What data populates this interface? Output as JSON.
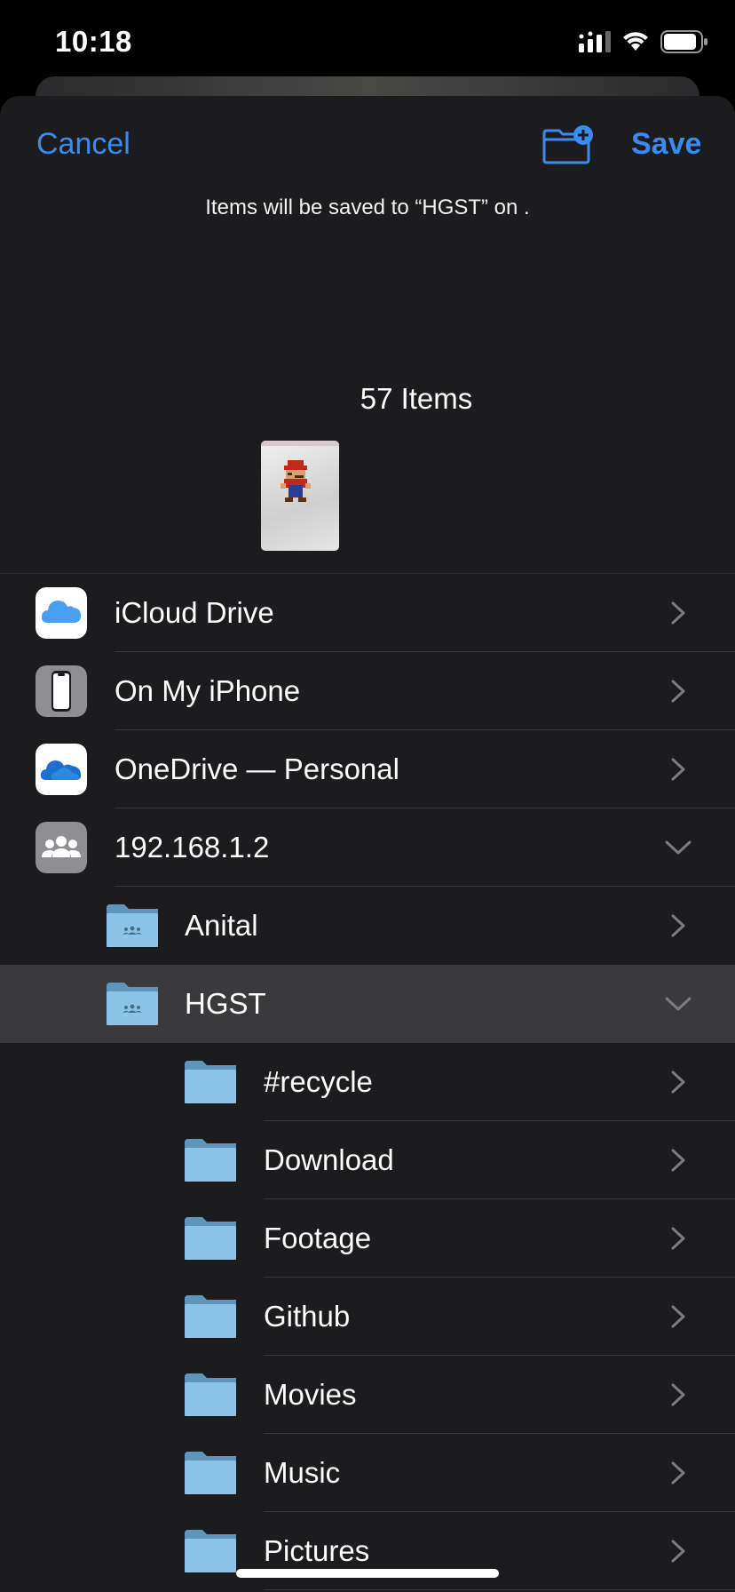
{
  "status_bar": {
    "time": "10:18"
  },
  "nav": {
    "cancel_label": "Cancel",
    "save_label": "Save"
  },
  "save_message": "Items will be saved to “HGST” on .",
  "item_count": "57 Items",
  "colors": {
    "accent": "#3a8bf0",
    "sheet_bg": "#1c1c1e",
    "selected_row": "#3a3a3c",
    "folder_blue": "#8cc4e8"
  },
  "locations": [
    {
      "label": "iCloud Drive",
      "icon": "icloud-icon",
      "chevron": "right"
    },
    {
      "label": "On My iPhone",
      "icon": "iphone-icon",
      "chevron": "right"
    },
    {
      "label": "OneDrive — Personal",
      "icon": "onedrive-icon",
      "chevron": "right"
    },
    {
      "label": "192.168.1.2",
      "icon": "server-icon",
      "chevron": "down"
    }
  ],
  "shares": [
    {
      "label": "Anital",
      "icon": "shared-folder-icon",
      "chevron": "right",
      "selected": false
    },
    {
      "label": "HGST",
      "icon": "shared-folder-icon",
      "chevron": "down",
      "selected": true
    }
  ],
  "folders": [
    {
      "label": "#recycle"
    },
    {
      "label": "Download"
    },
    {
      "label": "Footage"
    },
    {
      "label": "Github"
    },
    {
      "label": "Movies"
    },
    {
      "label": "Music"
    },
    {
      "label": "Pictures"
    }
  ]
}
